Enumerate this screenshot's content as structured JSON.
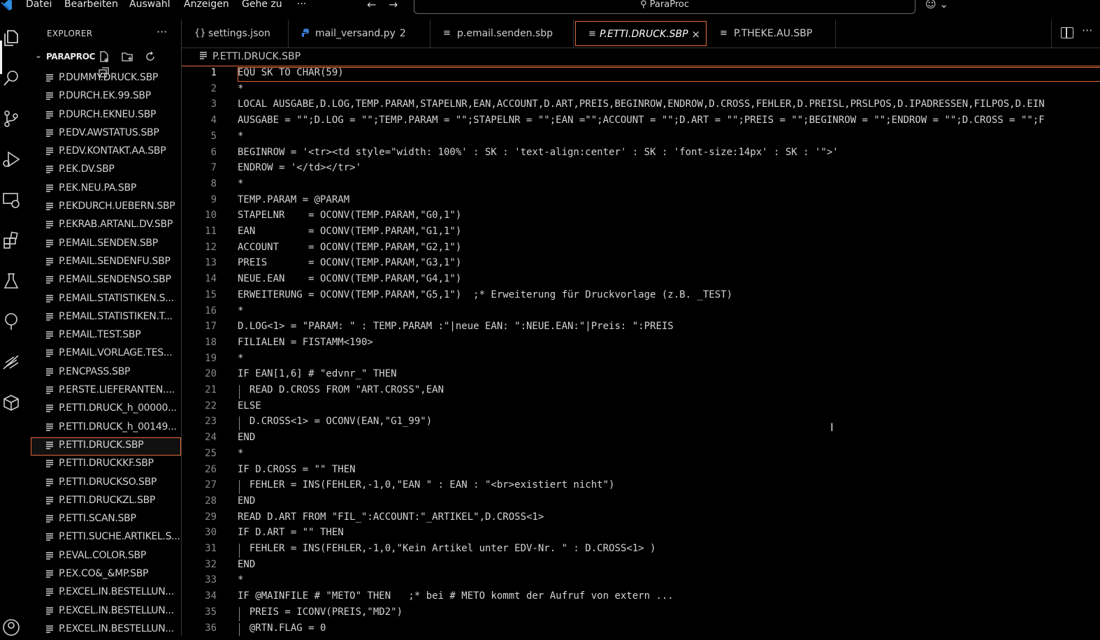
{
  "titlebar": {
    "menus": [
      "Datei",
      "Bearbeiten",
      "Auswahl",
      "Anzeigen",
      "Gehe zu"
    ],
    "more": "···",
    "search_text": "ParaProc"
  },
  "explorer": {
    "title": "EXPLORER",
    "more": "···",
    "folder_name": "PARAPROC",
    "files": [
      "P.DUMMY.DRUCK.SBP",
      "P.DURCH.EK.99.SBP",
      "P.DURCH.EKNEU.SBP",
      "P.EDV.AWSTATUS.SBP",
      "P.EDV.KONTAKT.AA.SBP",
      "P.EK.DV.SBP",
      "P.EK.NEU.PA.SBP",
      "P.EKDURCH.UEBERN.SBP",
      "P.EKRAB.ARTANL.DV.SBP",
      "P.EMAIL.SENDEN.SBP",
      "P.EMAIL.SENDENFU.SBP",
      "P.EMAIL.SENDENSO.SBP",
      "P.EMAIL.STATISTIKEN.S...",
      "P.EMAIL.STATISTIKEN.T...",
      "P.EMAIL.TEST.SBP",
      "P.EMAIL.VORLAGE.TES...",
      "P.ENCPASS.SBP",
      "P.ERSTE.LIEFERANTEN....",
      "P.ETTI.DRUCK_h_00000...",
      "P.ETTI.DRUCK_h_00149...",
      "P.ETTI.DRUCK.SBP",
      "P.ETTI.DRUCKKF.SBP",
      "P.ETTI.DRUCKSO.SBP",
      "P.ETTI.DRUCKZL.SBP",
      "P.ETTI.SCAN.SBP",
      "P.ETTI.SUCHE.ARTIKEL.S...",
      "P.EVAL.COLOR.SBP",
      "P.EX.CO&_&MP.SBP",
      "P.EXCEL.IN.BESTELLUN...",
      "P.EXCEL.IN.BESTELLUN...",
      "P.EXCEL.IN.BESTELLUN..."
    ],
    "active_index": 20
  },
  "tabs": [
    {
      "icon": "{}",
      "label": "settings.json",
      "badge": ""
    },
    {
      "icon": "py",
      "label": "mail_versand.py",
      "badge": "2"
    },
    {
      "icon": "≡",
      "label": "p.email.senden.sbp",
      "badge": ""
    },
    {
      "icon": "≡",
      "label": "P.ETTI.DRUCK.SBP",
      "badge": ""
    },
    {
      "icon": "≡",
      "label": "P.THEKE.AU.SBP",
      "badge": ""
    }
  ],
  "tab_close": "×",
  "tabs_more": "···",
  "breadcrumb": "P.ETTI.DRUCK.SBP",
  "editor": {
    "lines": [
      {
        "n": "1",
        "text": "EQU SK TO CHAR(59)"
      },
      {
        "n": "2",
        "text": "*"
      },
      {
        "n": "3",
        "text": "LOCAL AUSGABE,D.LOG,TEMP.PARAM,STAPELNR,EAN,ACCOUNT,D.ART,PREIS,BEGINROW,ENDROW,D.CROSS,FEHLER,D.PREISL,PRSLPOS,D.IPADRESSEN,FILPOS,D.EIN"
      },
      {
        "n": "4",
        "text": "AUSGABE = \"\";D.LOG = \"\";TEMP.PARAM = \"\";STAPELNR = \"\";EAN =\"\";ACCOUNT = \"\";D.ART = \"\";PREIS = \"\";BEGINROW = \"\";ENDROW = \"\";D.CROSS = \"\";F"
      },
      {
        "n": "5",
        "text": "*"
      },
      {
        "n": "6",
        "text": "BEGINROW = '<tr><td style=\"width: 100%' : SK : 'text-align:center' : SK : 'font-size:14px' : SK : '\">'"
      },
      {
        "n": "7",
        "text": "ENDROW = '</td></tr>'"
      },
      {
        "n": "8",
        "text": "*"
      },
      {
        "n": "9",
        "text": "TEMP.PARAM = @PARAM"
      },
      {
        "n": "10",
        "text": "STAPELNR    = OCONV(TEMP.PARAM,\"G0,1\")"
      },
      {
        "n": "11",
        "text": "EAN         = OCONV(TEMP.PARAM,\"G1,1\")"
      },
      {
        "n": "12",
        "text": "ACCOUNT     = OCONV(TEMP.PARAM,\"G2,1\")"
      },
      {
        "n": "13",
        "text": "PREIS       = OCONV(TEMP.PARAM,\"G3,1\")"
      },
      {
        "n": "14",
        "text": "NEUE.EAN    = OCONV(TEMP.PARAM,\"G4,1\")"
      },
      {
        "n": "15",
        "text": "ERWEITERUNG = OCONV(TEMP.PARAM,\"G5,1\")  ;* Erweiterung für Druckvorlage (z.B. _TEST)"
      },
      {
        "n": "16",
        "text": "*"
      },
      {
        "n": "17",
        "text": "D.LOG<1> = \"PARAM: \" : TEMP.PARAM :\"|neue EAN: \":NEUE.EAN:\"|Preis: \":PREIS"
      },
      {
        "n": "18",
        "text": "FILIALEN = FISTAMM<190>"
      },
      {
        "n": "19",
        "text": "*"
      },
      {
        "n": "20",
        "text": "IF EAN[1,6] # \"edvnr_\" THEN"
      },
      {
        "n": "21",
        "text": "  READ D.CROSS FROM \"ART.CROSS\",EAN"
      },
      {
        "n": "22",
        "text": "ELSE"
      },
      {
        "n": "23",
        "text": "  D.CROSS<1> = OCONV(EAN,\"G1_99\")"
      },
      {
        "n": "24",
        "text": "END"
      },
      {
        "n": "25",
        "text": "*"
      },
      {
        "n": "26",
        "text": "IF D.CROSS = \"\" THEN"
      },
      {
        "n": "27",
        "text": "  FEHLER = INS(FEHLER,-1,0,\"EAN \" : EAN : \"<br>existiert nicht\")"
      },
      {
        "n": "28",
        "text": "END"
      },
      {
        "n": "29",
        "text": "READ D.ART FROM \"FIL_\":ACCOUNT:\"_ARTIKEL\",D.CROSS<1>"
      },
      {
        "n": "30",
        "text": "IF D.ART = \"\" THEN"
      },
      {
        "n": "31",
        "text": "  FEHLER = INS(FEHLER,-1,0,\"Kein Artikel unter EDV-Nr. \" : D.CROSS<1> )"
      },
      {
        "n": "32",
        "text": "END"
      },
      {
        "n": "33",
        "text": "*"
      },
      {
        "n": "34",
        "text": "IF @MAINFILE # \"METO\" THEN   ;* bei # METO kommt der Aufruf von extern ..."
      },
      {
        "n": "35",
        "text": "  PREIS = ICONV(PREIS,\"MD2\")"
      },
      {
        "n": "36",
        "text": "  @RTN.FLAG = 0"
      }
    ],
    "indented_lines": [
      21,
      23,
      27,
      31,
      35,
      36
    ]
  }
}
